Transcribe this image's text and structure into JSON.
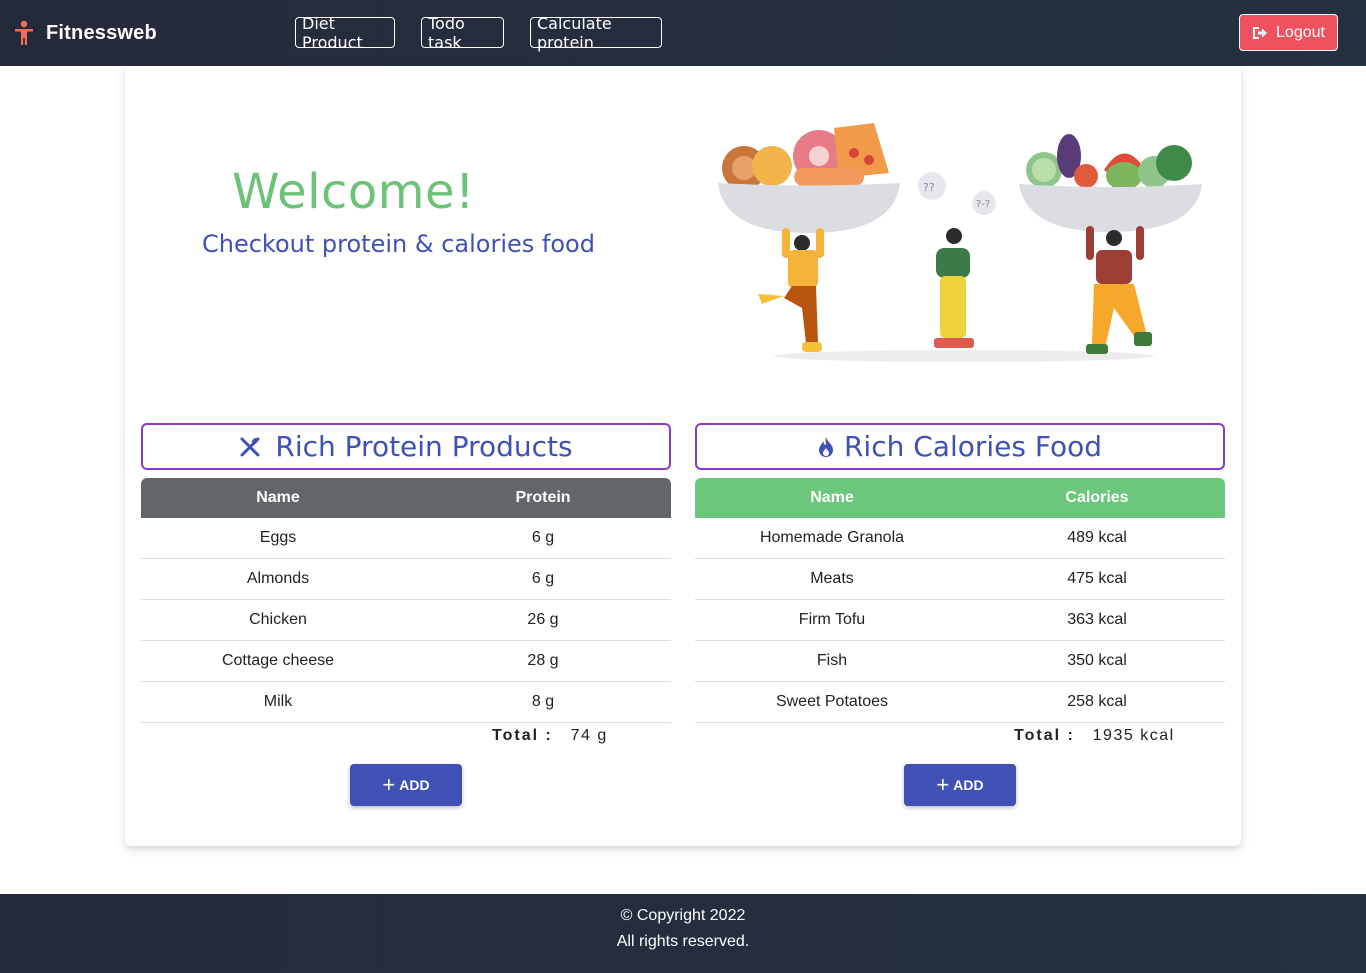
{
  "navbar": {
    "brand": "Fitnessweb",
    "links": [
      {
        "label": "Diet Product"
      },
      {
        "label": "Todo task"
      },
      {
        "label": "Calculate protein"
      }
    ],
    "logout_label": "Logout"
  },
  "hero": {
    "title": "Welcome!",
    "subtitle": "Checkout protein & calories food"
  },
  "protein_section": {
    "title": "Rich Protein Products",
    "columns": [
      "Name",
      "Protein"
    ],
    "rows": [
      {
        "name": "Eggs",
        "value": "6 g"
      },
      {
        "name": "Almonds",
        "value": "6 g"
      },
      {
        "name": "Chicken",
        "value": "26 g"
      },
      {
        "name": "Cottage cheese",
        "value": "28 g"
      },
      {
        "name": "Milk",
        "value": "8 g"
      }
    ],
    "total_label": "Total :",
    "total_value": "74 g",
    "add_label": "ADD"
  },
  "calories_section": {
    "title": "Rich Calories Food",
    "columns": [
      "Name",
      "Calories"
    ],
    "rows": [
      {
        "name": "Homemade Granola",
        "value": "489 kcal"
      },
      {
        "name": "Meats",
        "value": "475 kcal"
      },
      {
        "name": "Firm Tofu",
        "value": "363 kcal"
      },
      {
        "name": "Fish",
        "value": "350 kcal"
      },
      {
        "name": "Sweet Potatoes",
        "value": "258 kcal"
      }
    ],
    "total_label": "Total :",
    "total_value": "1935 kcal",
    "add_label": "ADD"
  },
  "footer": {
    "copyright": "© Copyright 2022",
    "rights": "All rights reserved."
  },
  "colors": {
    "nav_bg": "#252a3b",
    "accent_blue": "#3f51b5",
    "accent_green": "#6cc277",
    "logout_red": "#f0515e",
    "header_border": "#8a3bc8"
  }
}
